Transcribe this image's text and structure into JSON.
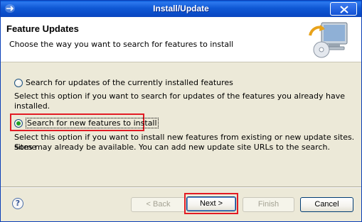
{
  "window": {
    "title": "Install/Update"
  },
  "header": {
    "title": "Feature Updates",
    "description": "Choose the way you want to search for features to install"
  },
  "options": [
    {
      "label": "Search for updates of the currently installed features",
      "description": "Select this option if you want to search for updates of the features you already have installed.",
      "selected": false
    },
    {
      "label": "Search for new features to install",
      "description_line1": "Select this option if you want to install new features from existing or new update sites. Some",
      "description_line2": "sites may already be available. You can add new update site URLs to the search.",
      "selected": true
    }
  ],
  "buttons": {
    "help": "?",
    "back": "< Back",
    "next": "Next >",
    "finish": "Finish",
    "cancel": "Cancel"
  },
  "colors": {
    "titlebar": "#0a4cc8",
    "highlight": "#e21b24",
    "selected_radio": "#21a121"
  },
  "icons": [
    "eclipse-window-icon",
    "close-icon",
    "update-wizard-icon",
    "help-icon"
  ]
}
